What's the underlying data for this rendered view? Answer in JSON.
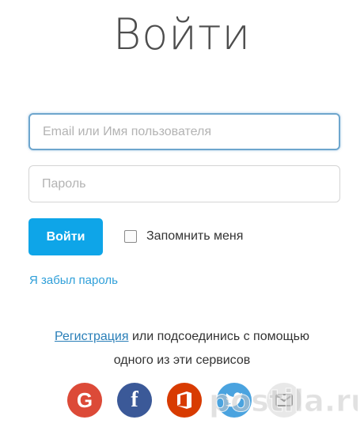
{
  "title": "Войти",
  "form": {
    "email_placeholder": "Email или Имя пользователя",
    "password_placeholder": "Пароль",
    "login_button": "Войти",
    "remember_label": "Запомнить меня",
    "forgot_link": "Я забыл пароль"
  },
  "register": {
    "link_text": "Регистрация",
    "rest_line1": " или подсоединись с помощью",
    "line2": "одного из эти сервисов"
  },
  "social": {
    "google_letter": "G",
    "facebook_letter": "f",
    "icons": [
      "google-icon",
      "facebook-icon",
      "office-icon",
      "twitter-icon",
      "mail-icon"
    ]
  },
  "watermark": "postila.ru",
  "colors": {
    "accent": "#0ea5e8",
    "link": "#2f9fd9",
    "google": "#dc4a38",
    "facebook": "#3b5998",
    "office": "#d83b01",
    "twitter": "#4aa3df"
  }
}
